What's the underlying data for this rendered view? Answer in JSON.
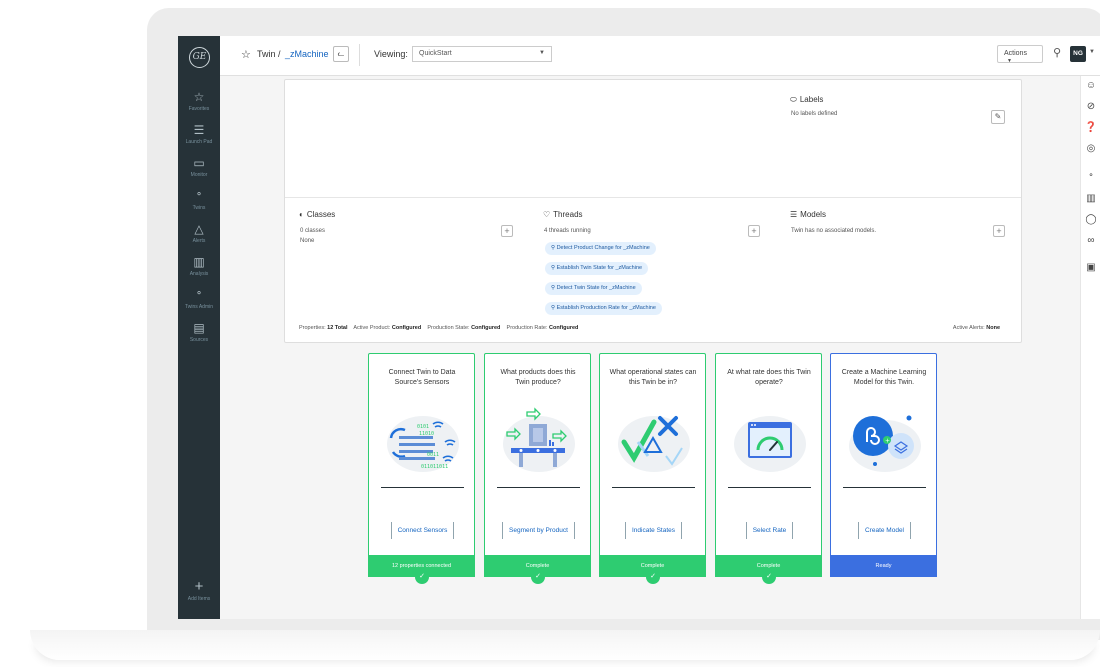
{
  "nav": {
    "items": [
      {
        "label": "Favorites",
        "icon": "star-icon",
        "glyph": "☆"
      },
      {
        "label": "Launch Pad",
        "icon": "launchpad-icon",
        "glyph": "☰"
      },
      {
        "label": "Monitor",
        "icon": "monitor-icon",
        "glyph": "▭"
      },
      {
        "label": "Twins",
        "icon": "twins-icon",
        "glyph": "ᐤ"
      },
      {
        "label": "Alerts",
        "icon": "bell-icon",
        "glyph": "△"
      },
      {
        "label": "Analysis",
        "icon": "chart-icon",
        "glyph": "▥"
      },
      {
        "label": "Twins Admin",
        "icon": "twins-admin-icon",
        "glyph": "ᐤ"
      },
      {
        "label": "Sources",
        "icon": "database-icon",
        "glyph": "▤"
      }
    ],
    "add": {
      "label": "Add Items",
      "glyph": "+"
    }
  },
  "topbar": {
    "crumb_root": "Twin /",
    "crumb_current": "_zMachine",
    "viewing_label": "Viewing:",
    "viewing_value": "QuickStart",
    "actions_label": "Actions",
    "avatar": "NG"
  },
  "panel": {
    "labels": {
      "title": "Labels",
      "text": "No labels defined"
    },
    "classes": {
      "title": "Classes",
      "count": "0 classes",
      "value": "None"
    },
    "threads": {
      "title": "Threads",
      "count": "4 threads running",
      "items": [
        "Detect Product Change for _zMachine",
        "Establish Twin State for _zMachine",
        "Detect Twin State for _zMachine",
        "Establish Production Rate for _zMachine"
      ]
    },
    "models": {
      "title": "Models",
      "text": "Twin has no associated models."
    },
    "footer": {
      "properties_label": "Properties:",
      "properties_value": "12 Total",
      "active_product_label": "Active Product:",
      "active_product_value": "Configured",
      "production_state_label": "Production State:",
      "production_state_value": "Configured",
      "production_rate_label": "Production Rate:",
      "production_rate_value": "Configured",
      "active_alerts_label": "Active Alerts:",
      "active_alerts_value": "None"
    }
  },
  "cards": [
    {
      "title": "Connect Twin to Data Source's Sensors",
      "button": "Connect Sensors",
      "status": "12 properties connected",
      "state": "complete"
    },
    {
      "title": "What products does this Twin produce?",
      "button": "Segment by Product",
      "status": "Complete",
      "state": "complete"
    },
    {
      "title": "What operational states can this Twin be in?",
      "button": "Indicate States",
      "status": "Complete",
      "state": "complete"
    },
    {
      "title": "At what rate does this Twin operate?",
      "button": "Select Rate",
      "status": "Complete",
      "state": "complete"
    },
    {
      "title": "Create a Machine Learning Model for this Twin.",
      "button": "Create Model",
      "status": "Ready",
      "state": "ready"
    }
  ],
  "colors": {
    "complete": "#2ecc71",
    "ready": "#3b6fe0",
    "nav_bg": "#263238",
    "link": "#1565c0"
  }
}
